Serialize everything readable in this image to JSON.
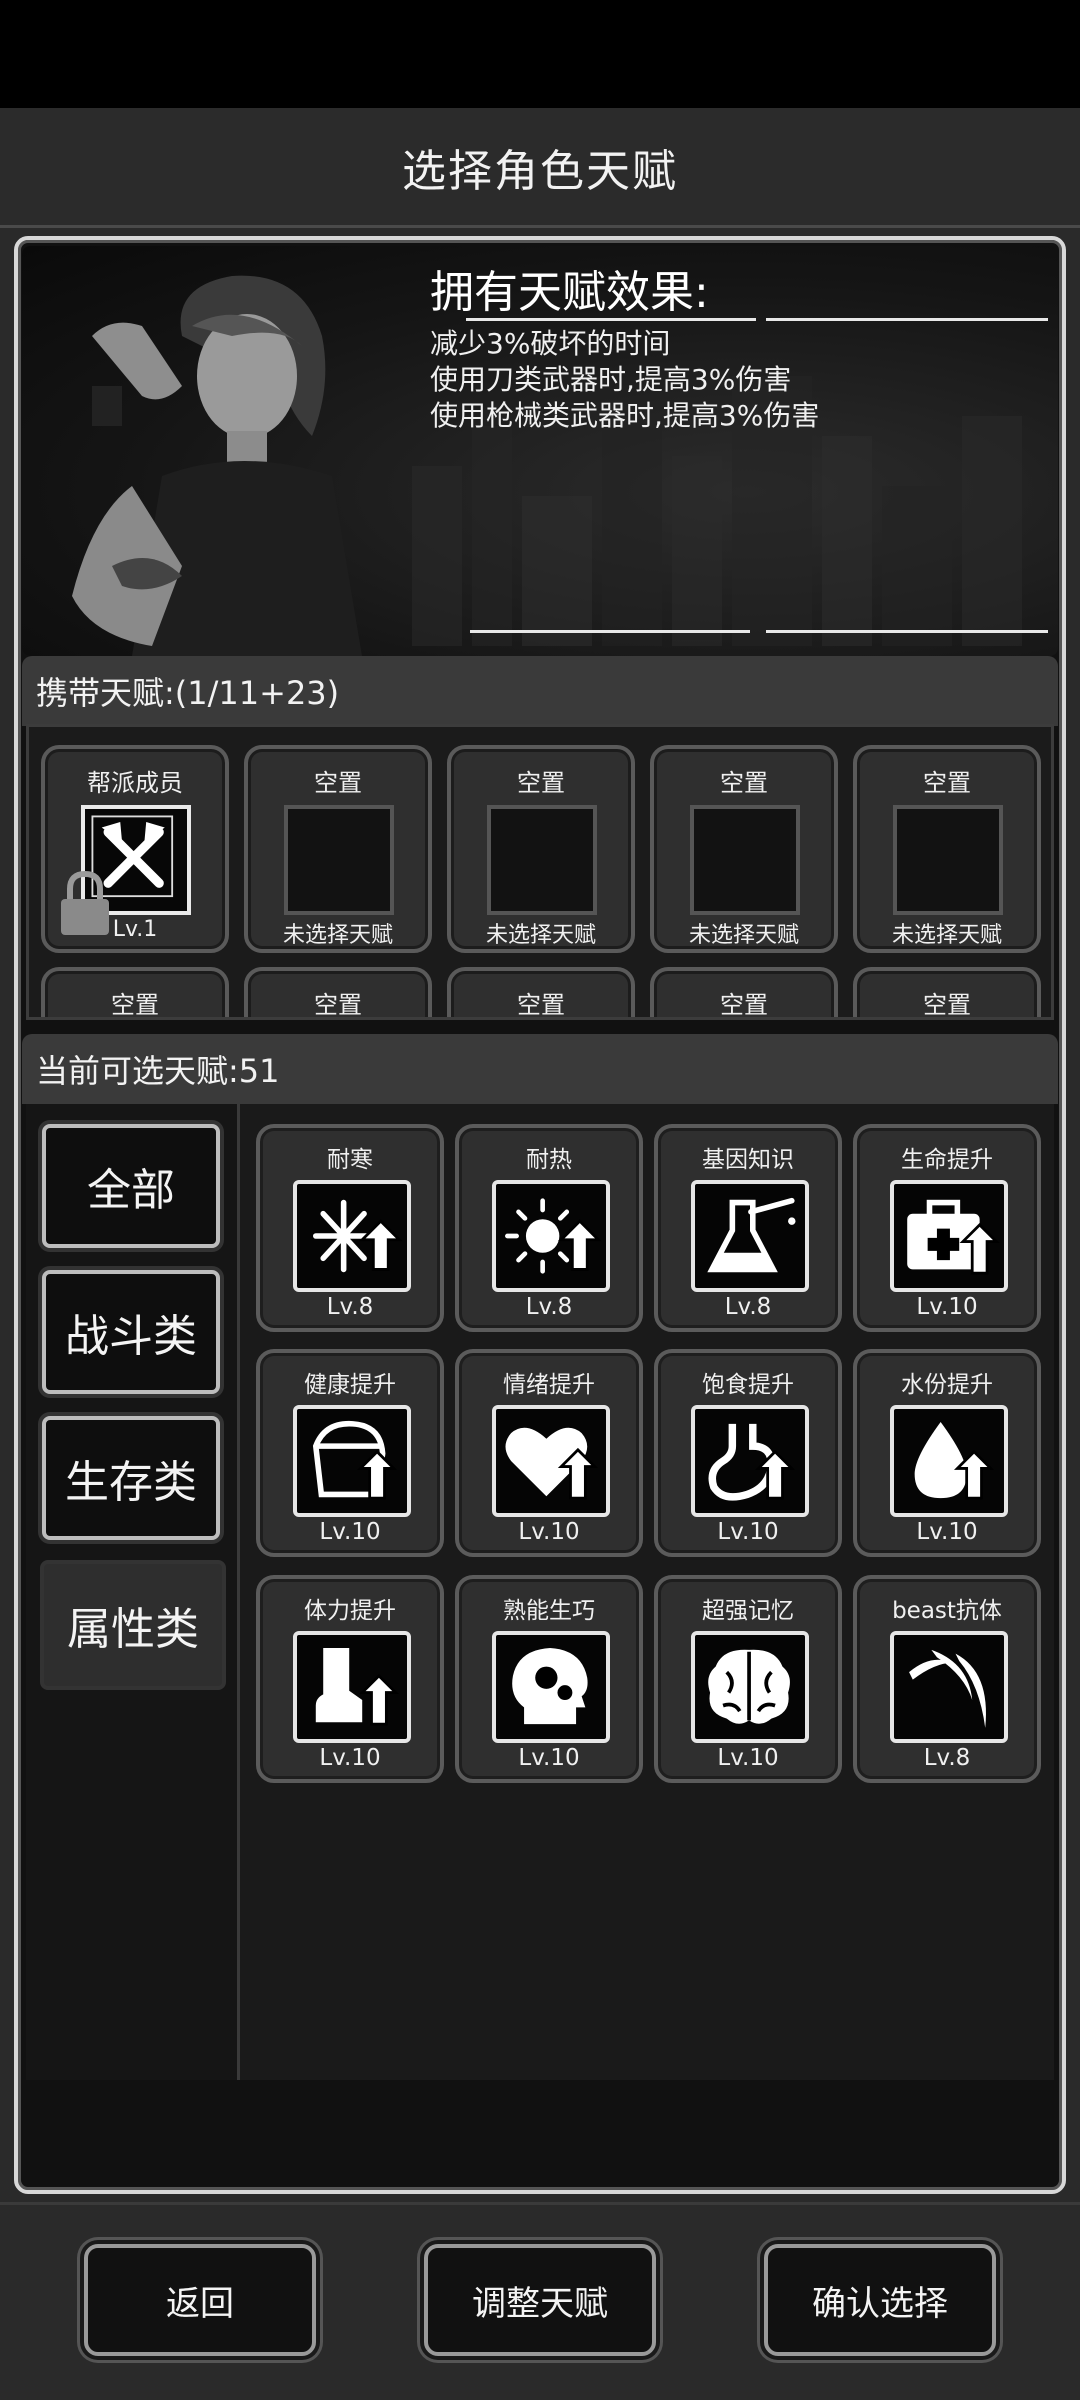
{
  "header": {
    "title": "选择角色天赋"
  },
  "effects": {
    "title": "拥有天赋效果:",
    "lines": [
      "减少3%破坏的时间",
      "使用刀类武器时,提高3%伤害",
      "使用枪械类武器时,提高3%伤害"
    ]
  },
  "carried": {
    "label": "携带天赋:(1/11+23)",
    "slots": [
      {
        "title": "帮派成员",
        "sub": "Lv.1",
        "icon": "crossed-axes-icon",
        "locked": true
      },
      {
        "title": "空置",
        "sub": "未选择天赋"
      },
      {
        "title": "空置",
        "sub": "未选择天赋"
      },
      {
        "title": "空置",
        "sub": "未选择天赋"
      },
      {
        "title": "空置",
        "sub": "未选择天赋"
      },
      {
        "title": "空置",
        "sub": ""
      },
      {
        "title": "空置",
        "sub": ""
      },
      {
        "title": "空置",
        "sub": ""
      },
      {
        "title": "空置",
        "sub": ""
      },
      {
        "title": "空置",
        "sub": ""
      }
    ]
  },
  "available": {
    "label": "当前可选天赋:51",
    "categories": [
      "全部",
      "战斗类",
      "生存类",
      "属性类"
    ],
    "active_category": "属性类",
    "talents": [
      {
        "name": "耐寒",
        "level": "Lv.8",
        "icon": "snowflake-up-icon"
      },
      {
        "name": "耐热",
        "level": "Lv.8",
        "icon": "sun-up-icon"
      },
      {
        "name": "基因知识",
        "level": "Lv.8",
        "icon": "flask-icon"
      },
      {
        "name": "生命提升",
        "level": "Lv.10",
        "icon": "medkit-up-icon"
      },
      {
        "name": "健康提升",
        "level": "Lv.10",
        "icon": "health-up-icon"
      },
      {
        "name": "情绪提升",
        "level": "Lv.10",
        "icon": "heart-up-icon"
      },
      {
        "name": "饱食提升",
        "level": "Lv.10",
        "icon": "stomach-up-icon"
      },
      {
        "name": "水份提升",
        "level": "Lv.10",
        "icon": "water-drop-up-icon"
      },
      {
        "name": "体力提升",
        "level": "Lv.10",
        "icon": "boot-up-icon"
      },
      {
        "name": "熟能生巧",
        "level": "Lv.10",
        "icon": "head-gears-icon"
      },
      {
        "name": "超强记忆",
        "level": "Lv.10",
        "icon": "brain-icon"
      },
      {
        "name": "beast抗体",
        "level": "Lv.8",
        "icon": "claw-icon"
      }
    ]
  },
  "footer": {
    "back": "返回",
    "adjust": "调整天赋",
    "confirm": "确认选择"
  }
}
